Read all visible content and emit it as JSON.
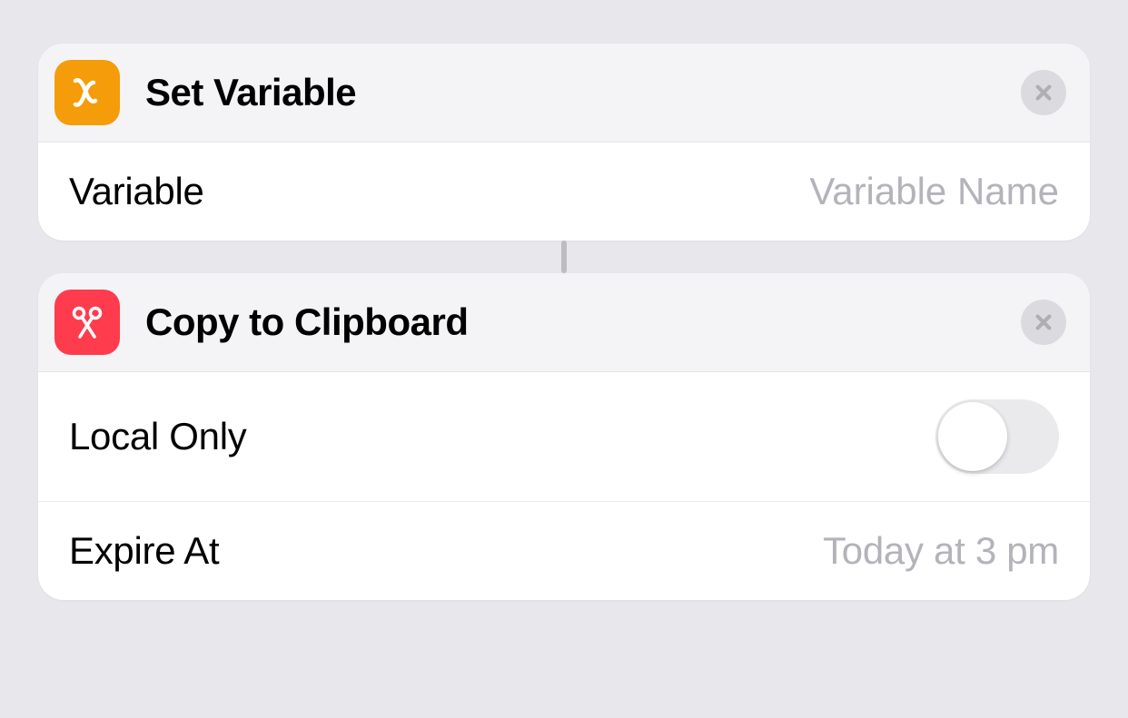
{
  "actions": [
    {
      "title": "Set Variable",
      "icon": "variable-x-icon",
      "rows": {
        "variable": {
          "label": "Variable",
          "placeholder": "Variable Name",
          "value": ""
        }
      }
    },
    {
      "title": "Copy to Clipboard",
      "icon": "scissors-icon",
      "rows": {
        "local_only": {
          "label": "Local Only",
          "toggle": false
        },
        "expire_at": {
          "label": "Expire At",
          "value": "Today at 3 pm"
        }
      }
    }
  ]
}
